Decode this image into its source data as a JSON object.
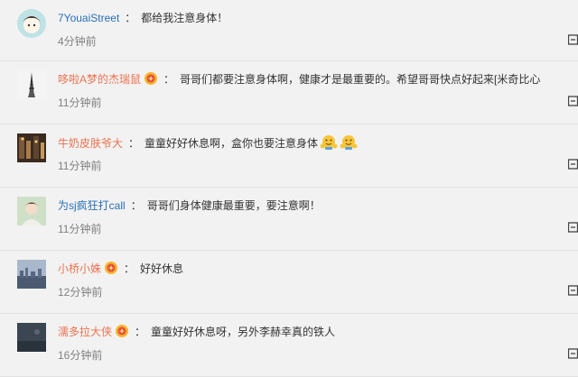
{
  "comments": [
    {
      "user": "7YouaiStreet",
      "user_color": "blue",
      "medal": false,
      "text": "都给我注意身体！",
      "time": "4分钟前",
      "emojis": 0,
      "avatar": "cartoon-face"
    },
    {
      "user": "哆啦A梦的杰瑞鼠",
      "user_color": "orange",
      "medal": true,
      "text": "哥哥们都要注意身体啊，健康才是最重要的。希望哥哥快点好起来[米奇比心",
      "time": "11分钟前",
      "emojis": 0,
      "avatar": "eiffel-tower"
    },
    {
      "user": "牛奶皮肤爷大",
      "user_color": "orange",
      "medal": false,
      "text": "童童好好休息啊，盒你也要注意身体",
      "time": "11分钟前",
      "emojis": 2,
      "avatar": "city-night"
    },
    {
      "user": "为sj疯狂打call",
      "user_color": "blue",
      "medal": false,
      "text": "哥哥们身体健康最重要，要注意啊！",
      "time": "11分钟前",
      "emojis": 0,
      "avatar": "person-photo"
    },
    {
      "user": "小桥小姝",
      "user_color": "orange",
      "medal": true,
      "text": "好好休息",
      "time": "12分钟前",
      "emojis": 0,
      "avatar": "skyline"
    },
    {
      "user": "濡多拉大侠",
      "user_color": "orange",
      "medal": true,
      "text": "童童好好休息呀，另外李赫幸真的铁人",
      "time": "16分钟前",
      "emojis": 0,
      "avatar": "dark-photo"
    }
  ],
  "colors": {
    "orange": "#eb7350",
    "blue": "#2b6fb8",
    "time": "#808080"
  },
  "icons": {
    "medal": "medal-icon",
    "reply": "reply-icon",
    "emoji": "hug-emoji-icon"
  }
}
